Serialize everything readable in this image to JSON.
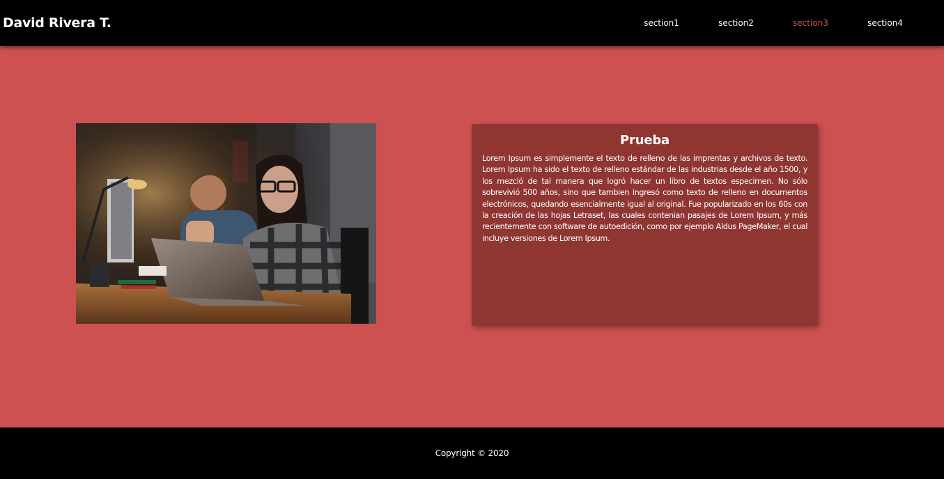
{
  "header": {
    "brand": "David Rivera T.",
    "nav": [
      {
        "label": "section1",
        "active": false
      },
      {
        "label": "section2",
        "active": false
      },
      {
        "label": "section3",
        "active": true
      },
      {
        "label": "section4",
        "active": false
      }
    ]
  },
  "main": {
    "card": {
      "title": "Prueba",
      "body": "Lorem Ipsum es simplemente el texto de relleno de las imprentas y archivos de texto. Lorem Ipsum ha sido el texto de relleno estándar de las industrias desde el año 1500, y los mezcló de tal manera que logró hacer un libro de textos especimen. No sólo sobrevivió 500 años, sino que tambien ingresó como texto de relleno en documentos electrónicos, quedando esencialmente igual al original. Fue popularizado en los 60s con la creación de las hojas Letraset, las cuales contenian pasajes de Lorem Ipsum, y más recientemente con software de autoedición, como por ejemplo Aldus PageMaker, el cual incluye versiones de Lorem Ipsum."
    }
  },
  "footer": {
    "copyright": "Copyright © 2020"
  },
  "colors": {
    "accent": "#cd5150",
    "card": "#8f3633",
    "bar": "#000000"
  }
}
